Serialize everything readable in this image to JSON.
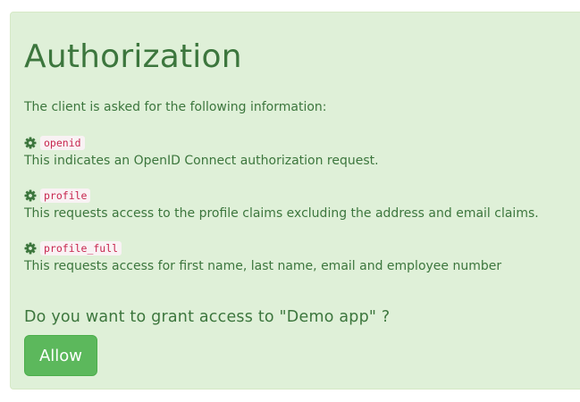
{
  "title": "Authorization",
  "intro": "The client is asked for the following information:",
  "scopes": [
    {
      "name": "openid",
      "description": "This indicates an OpenID Connect authorization request.",
      "icon": "gear-icon"
    },
    {
      "name": "profile",
      "description": "This requests access to the profile claims excluding the address and email claims.",
      "icon": "gear-icon"
    },
    {
      "name": "profile_full",
      "description": "This requests access for first name, last name, email and employee number",
      "icon": "gear-icon"
    }
  ],
  "question": "Do you want to grant access to \"Demo app\" ?",
  "allow_label": "Allow",
  "colors": {
    "panel_bg": "#dff0d8",
    "panel_border": "#d6e9c6",
    "text": "#3c763d",
    "button_bg": "#5cb85c",
    "code_text": "#c7254e",
    "code_bg": "#f9f2f4"
  }
}
